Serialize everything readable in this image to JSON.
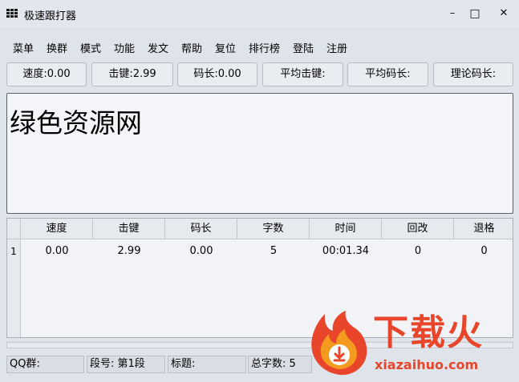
{
  "window": {
    "title": "极速跟打器",
    "icon": "grid-icon"
  },
  "window_controls": {
    "minimize": "–",
    "maximize": "□",
    "close": "✕"
  },
  "menu": [
    "菜单",
    "换群",
    "模式",
    "功能",
    "发文",
    "帮助",
    "复位",
    "排行榜",
    "登陆",
    "注册"
  ],
  "stats": {
    "speed": "速度:0.00",
    "keystroke": "击键:2.99",
    "code_length": "码长:0.00",
    "avg_keystroke": "平均击键:",
    "avg_code_length": "平均码长:",
    "theory_code_length": "理论码长:"
  },
  "text_area": {
    "content": "绿色资源网"
  },
  "table": {
    "headers": [
      "速度",
      "击键",
      "码长",
      "字数",
      "时间",
      "回改",
      "退格"
    ],
    "rows": [
      {
        "index": "1",
        "cells": [
          "0.00",
          "2.99",
          "0.00",
          "5",
          "00:01.34",
          "0",
          "0"
        ]
      }
    ]
  },
  "status_bar": {
    "qq_group": "QQ群:",
    "segment": "段号: 第1段",
    "title": "标题:",
    "total_chars": "总字数: 5"
  },
  "watermark": {
    "text": "下载火",
    "url": "xiazaihuo.com",
    "brand_color": "#e8452a",
    "icon": "flame-download-icon"
  }
}
